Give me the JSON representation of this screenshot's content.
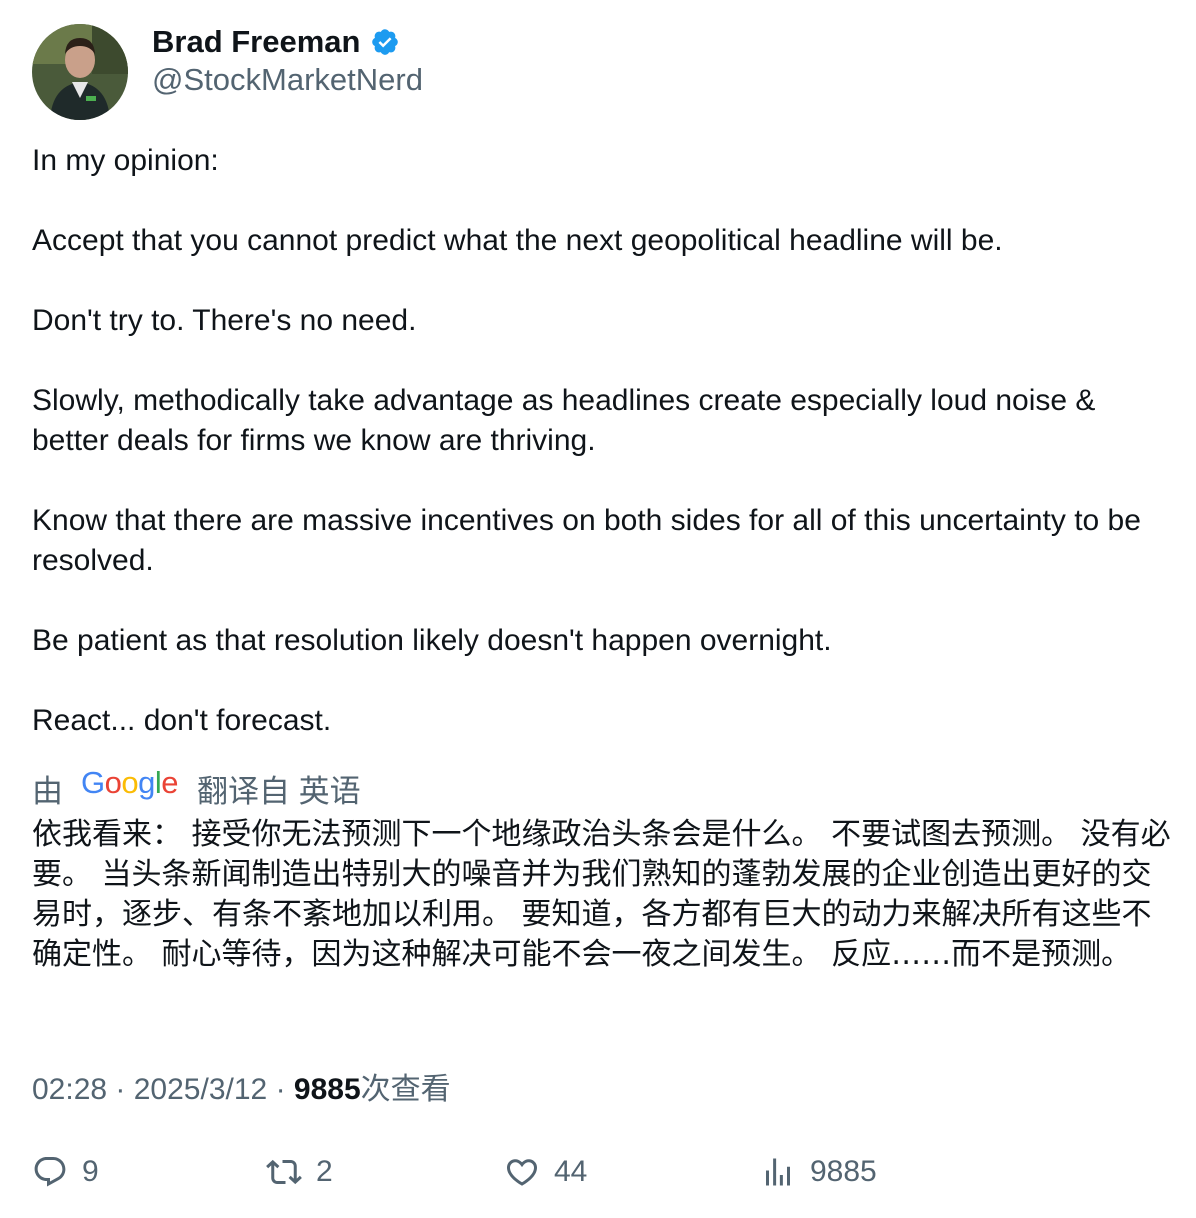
{
  "author": {
    "name": "Brad Freeman",
    "handle": "@StockMarketNerd",
    "verified_color": "#1d9bf0"
  },
  "tweet": {
    "paragraphs": [
      "In my opinion:",
      "Accept that you cannot predict what the next geopolitical headline will be.",
      "Don't try to. There's no need.",
      "Slowly, methodically take advantage as headlines create especially loud noise & better deals for firms we know are thriving.",
      "Know that there are massive incentives on both sides for all of this uncertainty to be resolved.",
      "Be patient as that resolution likely doesn't happen overnight.",
      "React... don't forecast."
    ]
  },
  "translation": {
    "by_label": "由",
    "provider_logo": "Google",
    "source_label": "翻译自 英语",
    "text": "依我看来： 接受你无法预测下一个地缘政治头条会是什么。 不要试图去预测。 没有必要。 当头条新闻制造出特别大的噪音并为我们熟知的蓬勃发展的企业创造出更好的交易时，逐步、有条不紊地加以利用。 要知道，各方都有巨大的动力来解决所有这些不确定性。 耐心等待，因为这种解决可能不会一夜之间发生。 反应……而不是预测。"
  },
  "meta": {
    "time": "02:28",
    "separator": "·",
    "date": "2025/3/12",
    "views_count": "9885",
    "views_label": "次查看"
  },
  "actions": {
    "replies": "9",
    "retweets": "2",
    "likes": "44",
    "views": "9885"
  },
  "colors": {
    "text": "#0f1419",
    "secondary": "#536471",
    "verified": "#1d9bf0"
  }
}
